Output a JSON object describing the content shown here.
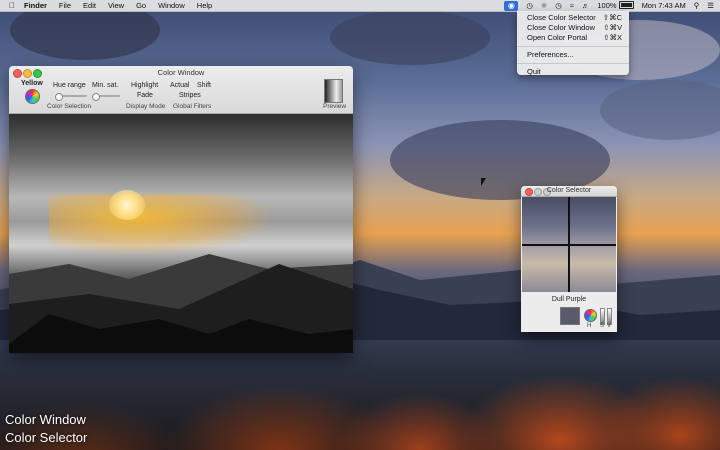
{
  "menubar": {
    "apple_icon": "apple-logo-icon",
    "items": [
      "Finder",
      "File",
      "Edit",
      "View",
      "Go",
      "Window",
      "Help"
    ],
    "battery_text": "100%",
    "clock": "Mon 7:43 AM"
  },
  "dropdown": {
    "items": [
      {
        "label": "Close Color Selector",
        "shortcut": "⇧⌘C"
      },
      {
        "label": "Close Color Window",
        "shortcut": "⇧⌘V"
      },
      {
        "label": "Open Color Portal",
        "shortcut": "⇧⌘X"
      }
    ],
    "preferences": "Preferences...",
    "quit": "Quit"
  },
  "color_window": {
    "title": "Color Window",
    "color_name": "Yellow",
    "hue_range_label": "Hue range",
    "min_sat_label": "Min. sat.",
    "hue_range_value": 0.1,
    "min_sat_value": 0.1,
    "highlight_label": "Highlight",
    "fade_label": "Fade",
    "actual_label": "Actual",
    "stripes_label": "Stripes",
    "shift_label": "Shift",
    "color_selection_caption": "Color Selection",
    "display_mode_caption": "Display Mode",
    "global_filters_caption": "Global Filters",
    "preview_caption": "Preview"
  },
  "color_selector": {
    "title": "Color Selector",
    "color_name": "Dull Purple",
    "swatch_color": "#5a5b6a",
    "h_label": "H",
    "s_label": "S",
    "v_label": "V"
  },
  "captions": {
    "line1": "Color Window",
    "line2": "Color Selector"
  }
}
